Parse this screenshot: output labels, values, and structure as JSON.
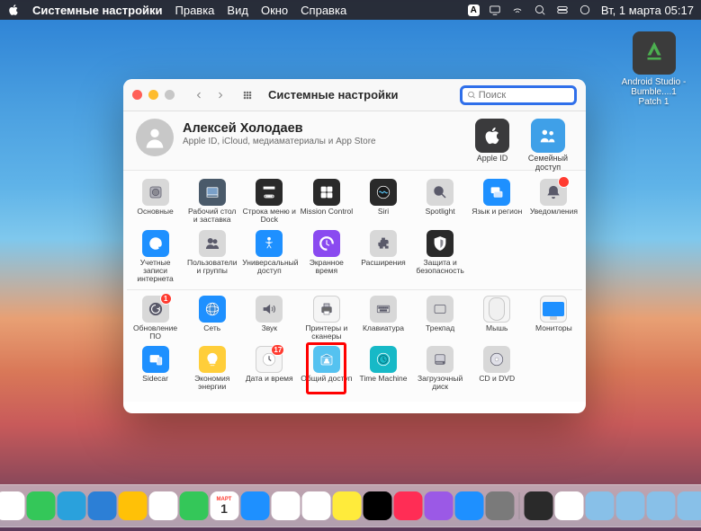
{
  "menubar": {
    "app": "Системные настройки",
    "items": [
      "Правка",
      "Вид",
      "Окно",
      "Справка"
    ],
    "lang": "А",
    "clock": "Вт, 1 марта  05:17"
  },
  "desktop": {
    "icons": [
      {
        "label": "Android Studio - Bumble....1 Patch 1"
      }
    ]
  },
  "window": {
    "title": "Системные настройки",
    "search_placeholder": "Поиск",
    "user": {
      "name": "Алексей Холодаев",
      "sub": "Apple ID, iCloud, медиаматериалы и App Store"
    },
    "user_actions": [
      {
        "label": "Apple ID",
        "icon": "apple"
      },
      {
        "label": "Семейный доступ",
        "icon": "family"
      }
    ],
    "prefs": [
      [
        {
          "label": "Основные",
          "icon": "general",
          "cls": "ic-gray"
        },
        {
          "label": "Рабочий стол и заставка",
          "icon": "desktop",
          "cls": "ic-slate"
        },
        {
          "label": "Строка меню и Dock",
          "icon": "dock",
          "cls": "ic-dark"
        },
        {
          "label": "Mission Control",
          "icon": "mission",
          "cls": "ic-dark"
        },
        {
          "label": "Siri",
          "icon": "siri",
          "cls": "ic-dark"
        },
        {
          "label": "Spotlight",
          "icon": "spotlight",
          "cls": "ic-gray"
        },
        {
          "label": "Язык и регион",
          "icon": "lang",
          "cls": "ic-blue"
        },
        {
          "label": "Уведомления",
          "icon": "notif",
          "cls": "ic-gray",
          "badge": " "
        }
      ],
      [
        {
          "label": "Учетные записи интернета",
          "icon": "at",
          "cls": "ic-blue"
        },
        {
          "label": "Пользователи и группы",
          "icon": "users",
          "cls": "ic-gray"
        },
        {
          "label": "Универсальный доступ",
          "icon": "access",
          "cls": "ic-blue"
        },
        {
          "label": "Экранное время",
          "icon": "screentime",
          "cls": "ic-purple"
        },
        {
          "label": "Расширения",
          "icon": "ext",
          "cls": "ic-gray"
        },
        {
          "label": "Защита и безопасность",
          "icon": "security",
          "cls": "ic-dark"
        }
      ],
      [
        {
          "label": "Обновление ПО",
          "icon": "update",
          "cls": "ic-gray",
          "badge": "1"
        },
        {
          "label": "Сеть",
          "icon": "network",
          "cls": "ic-blue"
        },
        {
          "label": "Звук",
          "icon": "sound",
          "cls": "ic-gray"
        },
        {
          "label": "Принтеры и сканеры",
          "icon": "printer",
          "cls": "ic-white"
        },
        {
          "label": "Клавиатура",
          "icon": "keyboard",
          "cls": "ic-gray"
        },
        {
          "label": "Трекпад",
          "icon": "trackpad",
          "cls": "ic-gray"
        },
        {
          "label": "Мышь",
          "icon": "mouse",
          "cls": "ic-white"
        },
        {
          "label": "Мониторы",
          "icon": "monitor",
          "cls": "ic-white"
        }
      ],
      [
        {
          "label": "Sidecar",
          "icon": "sidecar",
          "cls": "ic-blue"
        },
        {
          "label": "Экономия энергии",
          "icon": "energy",
          "cls": "ic-yellow"
        },
        {
          "label": "Дата и время",
          "icon": "datetime",
          "cls": "ic-white",
          "badge_text": "17"
        },
        {
          "label": "Общий доступ",
          "icon": "sharing",
          "cls": "ic-cyan",
          "highlighted": true
        },
        {
          "label": "Time Machine",
          "icon": "timemachine",
          "cls": "ic-teal"
        },
        {
          "label": "Загрузочный диск",
          "icon": "bootdisk",
          "cls": "ic-gray"
        },
        {
          "label": "CD и DVD",
          "icon": "cddvd",
          "cls": "ic-gray"
        }
      ]
    ]
  },
  "dock": {
    "items": [
      {
        "name": "finder",
        "bg": "#1e90ff"
      },
      {
        "name": "launchpad",
        "bg": "#e8e8e8"
      },
      {
        "name": "safari",
        "bg": "#ffffff"
      },
      {
        "name": "messages",
        "bg": "#34c759"
      },
      {
        "name": "telegram",
        "bg": "#2aa1dc"
      },
      {
        "name": "vscode",
        "bg": "#2c7fd6"
      },
      {
        "name": "pycharm",
        "bg": "#ffc107"
      },
      {
        "name": "chrome",
        "bg": "#ffffff"
      },
      {
        "name": "facetime",
        "bg": "#34c759"
      },
      {
        "name": "calendar",
        "bg": "#ffffff",
        "text": "1"
      },
      {
        "name": "xcode",
        "bg": "#1e90ff"
      },
      {
        "name": "preview",
        "bg": "#ffffff"
      },
      {
        "name": "notion",
        "bg": "#ffffff"
      },
      {
        "name": "notes",
        "bg": "#ffeb3b"
      },
      {
        "name": "tv",
        "bg": "#000000"
      },
      {
        "name": "music",
        "bg": "#ff2d55"
      },
      {
        "name": "podcasts",
        "bg": "#9b59e6"
      },
      {
        "name": "appstore",
        "bg": "#1e90ff"
      },
      {
        "name": "preferences",
        "bg": "#7a7a7a"
      }
    ],
    "right": [
      {
        "name": "terminal",
        "bg": "#2a2a2a"
      },
      {
        "name": "activity",
        "bg": "#ffffff"
      },
      {
        "name": "downloads",
        "bg": "#88c0e8"
      },
      {
        "name": "folder1",
        "bg": "#88c0e8"
      },
      {
        "name": "folder2",
        "bg": "#88c0e8"
      },
      {
        "name": "folder3",
        "bg": "#88c0e8"
      },
      {
        "name": "folder4",
        "bg": "#88c0e8"
      },
      {
        "name": "trash",
        "bg": "#d0d0d0"
      }
    ]
  }
}
